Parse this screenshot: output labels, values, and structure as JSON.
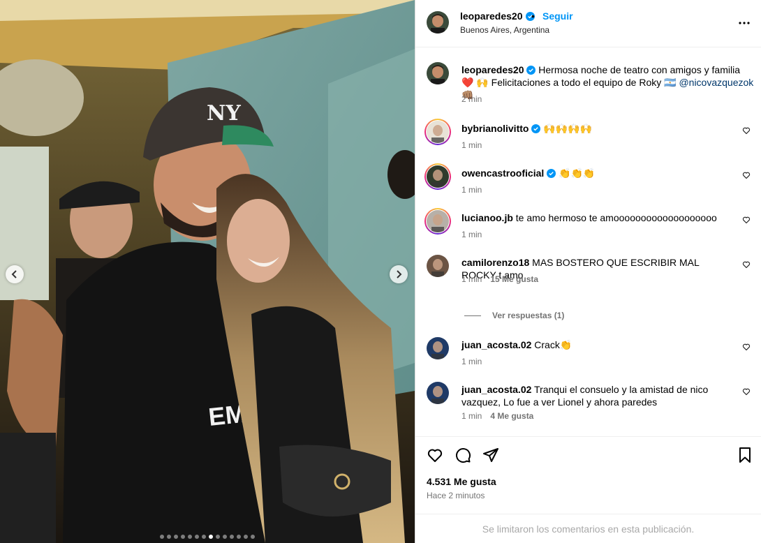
{
  "post": {
    "username": "leoparedes20",
    "follow_label": "Seguir",
    "separator": "•",
    "location": "Buenos Aires, Argentina",
    "caption_text": "Hermosa noche de teatro con amigos y familia ❤️ 🙌 Felicitaciones a todo el equipo de Roky 🇦🇷",
    "caption_mention": "@nicovazquezok",
    "caption_end": "👊🏽",
    "caption_time": "2 min",
    "likes": "4.531 Me gusta",
    "posted": "Hace 2 minutos",
    "comments_limited": "Se limitaron los comentarios en esta publicación.",
    "carousel": {
      "total": 14,
      "active_index": 7
    }
  },
  "comments": [
    {
      "user": "bybrianolivitto",
      "verified": true,
      "text": "🙌🙌🙌🙌",
      "time": "1 min",
      "likes": "",
      "story_ring": true
    },
    {
      "user": "owencastrooficial",
      "verified": true,
      "text": "👏👏👏",
      "time": "1 min",
      "likes": "",
      "story_ring": true
    },
    {
      "user": "lucianoo.jb",
      "verified": false,
      "text": "te amo hermoso te amooooooooooooooooooo",
      "time": "1 min",
      "likes": "",
      "story_ring": true
    },
    {
      "user": "camilorenzo18",
      "verified": false,
      "text": "MAS BOSTERO QUE ESCRIBIR MAL ROCKY t amo",
      "time": "1 min",
      "likes": "15 Me gusta",
      "story_ring": false
    },
    {
      "user": "juan_acosta.02",
      "verified": false,
      "text": "Crack👏",
      "time": "1 min",
      "likes": "",
      "story_ring": false
    },
    {
      "user": "juan_acosta.02",
      "verified": false,
      "text": "Tranqui el consuelo y la amistad de nico vazquez, Lo fue a ver Lionel y ahora paredes",
      "time": "1 min",
      "likes": "4 Me gusta",
      "story_ring": false
    }
  ],
  "replies_label": "Ver respuestas (1)",
  "icons": {
    "header": [
      "verified-icon",
      "more-options-icon"
    ],
    "actions": [
      "like-icon",
      "comment-icon",
      "share-icon",
      "save-icon"
    ],
    "carousel": [
      "chevron-left-icon",
      "chevron-right-icon"
    ]
  },
  "colors": {
    "accent": "#0095f6",
    "verified": "#0095f6",
    "heart": "#ed4956",
    "secondary_text": "#737373"
  }
}
